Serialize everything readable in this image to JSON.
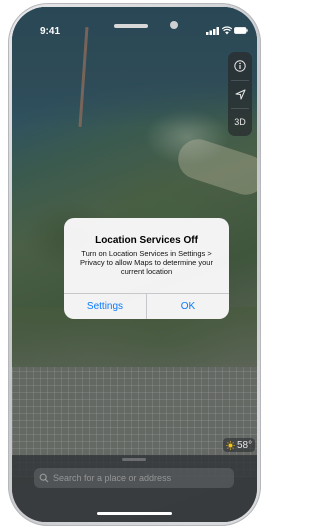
{
  "status_bar": {
    "time": "9:41"
  },
  "map_controls": {
    "info_icon": "info-icon",
    "location_icon": "location-arrow-icon",
    "three_d_label": "3D"
  },
  "alert": {
    "title": "Location Services Off",
    "message": "Turn on Location Services in Settings > Privacy to allow Maps to determine your current location",
    "settings_label": "Settings",
    "ok_label": "OK",
    "button_color": "#0a7aff"
  },
  "weather": {
    "icon": "sun-icon",
    "temperature": "58°"
  },
  "search": {
    "placeholder": "Search for a place or address"
  }
}
